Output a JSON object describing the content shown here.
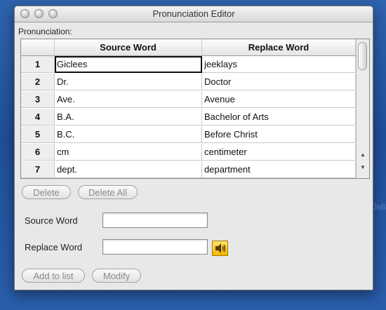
{
  "window": {
    "title": "Pronunciation Editor"
  },
  "section_label": "Pronunciation:",
  "table": {
    "columns": [
      "",
      "Source Word",
      "Replace Word"
    ],
    "rows": [
      {
        "index": "1",
        "source": "Giclees",
        "replace": "jeeklays"
      },
      {
        "index": "2",
        "source": "Dr.",
        "replace": "Doctor"
      },
      {
        "index": "3",
        "source": "Ave.",
        "replace": "Avenue"
      },
      {
        "index": "4",
        "source": "B.A.",
        "replace": "Bachelor of Arts"
      },
      {
        "index": "5",
        "source": "B.C.",
        "replace": "Before Christ"
      },
      {
        "index": "6",
        "source": "cm",
        "replace": "centimeter"
      },
      {
        "index": "7",
        "source": "dept.",
        "replace": "department"
      }
    ]
  },
  "buttons": {
    "delete": "Delete",
    "delete_all": "Delete All",
    "add_to_list": "Add to list",
    "modify": "Modify"
  },
  "form": {
    "source_label": "Source Word",
    "replace_label": "Replace Word",
    "source_value": "",
    "replace_value": ""
  },
  "icons": {
    "speaker": "speaker-icon"
  },
  "background_text": "0x8"
}
